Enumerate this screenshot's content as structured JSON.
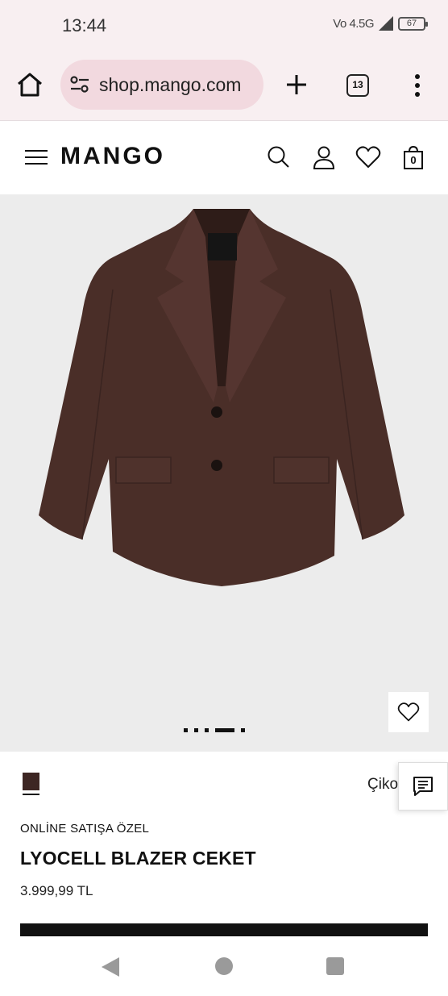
{
  "status_bar": {
    "time": "13:44",
    "network": "Vo 4.5G",
    "battery": "67"
  },
  "browser": {
    "url": "shop.mango.com",
    "tab_count": "13"
  },
  "site": {
    "logo": "MANGO",
    "cart_count": "0"
  },
  "product": {
    "image_dots_count": 5,
    "active_dot": 3,
    "swatch_color": "#3d2623",
    "color_name": "Çikolata",
    "tag": "ONLİNE SATIŞA ÖZEL",
    "title": "LYOCELL BLAZER CEKET",
    "price": "3.999,99 TL"
  },
  "colors": {
    "browser_bg": "#f8eff1",
    "url_pill": "#f2d9df",
    "image_bg": "#ececec",
    "blazer": "#4a2e28"
  }
}
